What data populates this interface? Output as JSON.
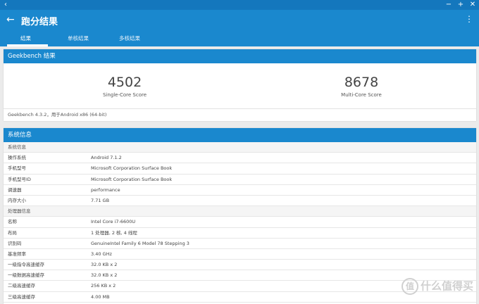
{
  "window": {
    "back_glyph": "‹",
    "controls": [
      "−",
      "+",
      "✕"
    ]
  },
  "header": {
    "title": "跑分结果",
    "tabs": [
      "结果",
      "单核结果",
      "多核结果"
    ],
    "active_tab": 0
  },
  "colors": {
    "primary": "#1a88ce",
    "status_bar": "#1477bd"
  },
  "geekbench": {
    "heading": "Geekbench 结果",
    "single_score": "4502",
    "single_label": "Single-Core Score",
    "multi_score": "8678",
    "multi_label": "Multi-Core Score",
    "footnote": "Geekbench 4.3.2，用于Android x86 (64-bit)"
  },
  "sysinfo": {
    "heading": "系统信息",
    "rows": [
      {
        "type": "section",
        "key": "系统信息",
        "value": ""
      },
      {
        "type": "row",
        "key": "操作系统",
        "value": "Android 7.1.2"
      },
      {
        "type": "row",
        "key": "手机型号",
        "value": "Microsoft Corporation Surface Book"
      },
      {
        "type": "row",
        "key": "手机型号ID",
        "value": "Microsoft Corporation Surface Book"
      },
      {
        "type": "row",
        "key": "调速器",
        "value": "performance"
      },
      {
        "type": "row",
        "key": "内存大小",
        "value": "7.71 GB"
      },
      {
        "type": "section",
        "key": "处理器信息",
        "value": ""
      },
      {
        "type": "row",
        "key": "名称",
        "value": "Intel Core i7-6600U"
      },
      {
        "type": "row",
        "key": "布局",
        "value": "1 处理器, 2 核, 4 线程"
      },
      {
        "type": "row",
        "key": "识别码",
        "value": "GenuineIntel Family 6 Model 78 Stepping 3"
      },
      {
        "type": "row",
        "key": "基准频率",
        "value": "3.40 GHz"
      },
      {
        "type": "row",
        "key": "一级指令高速缓存",
        "value": "32.0 KB x 2"
      },
      {
        "type": "row",
        "key": "一级数据高速缓存",
        "value": "32.0 KB x 2"
      },
      {
        "type": "row",
        "key": "二级高速缓存",
        "value": "256 KB x 2"
      },
      {
        "type": "row",
        "key": "三级高速缓存",
        "value": "4.00 MB"
      }
    ]
  },
  "watermark": {
    "badge": "值",
    "text": "什么值得买"
  }
}
